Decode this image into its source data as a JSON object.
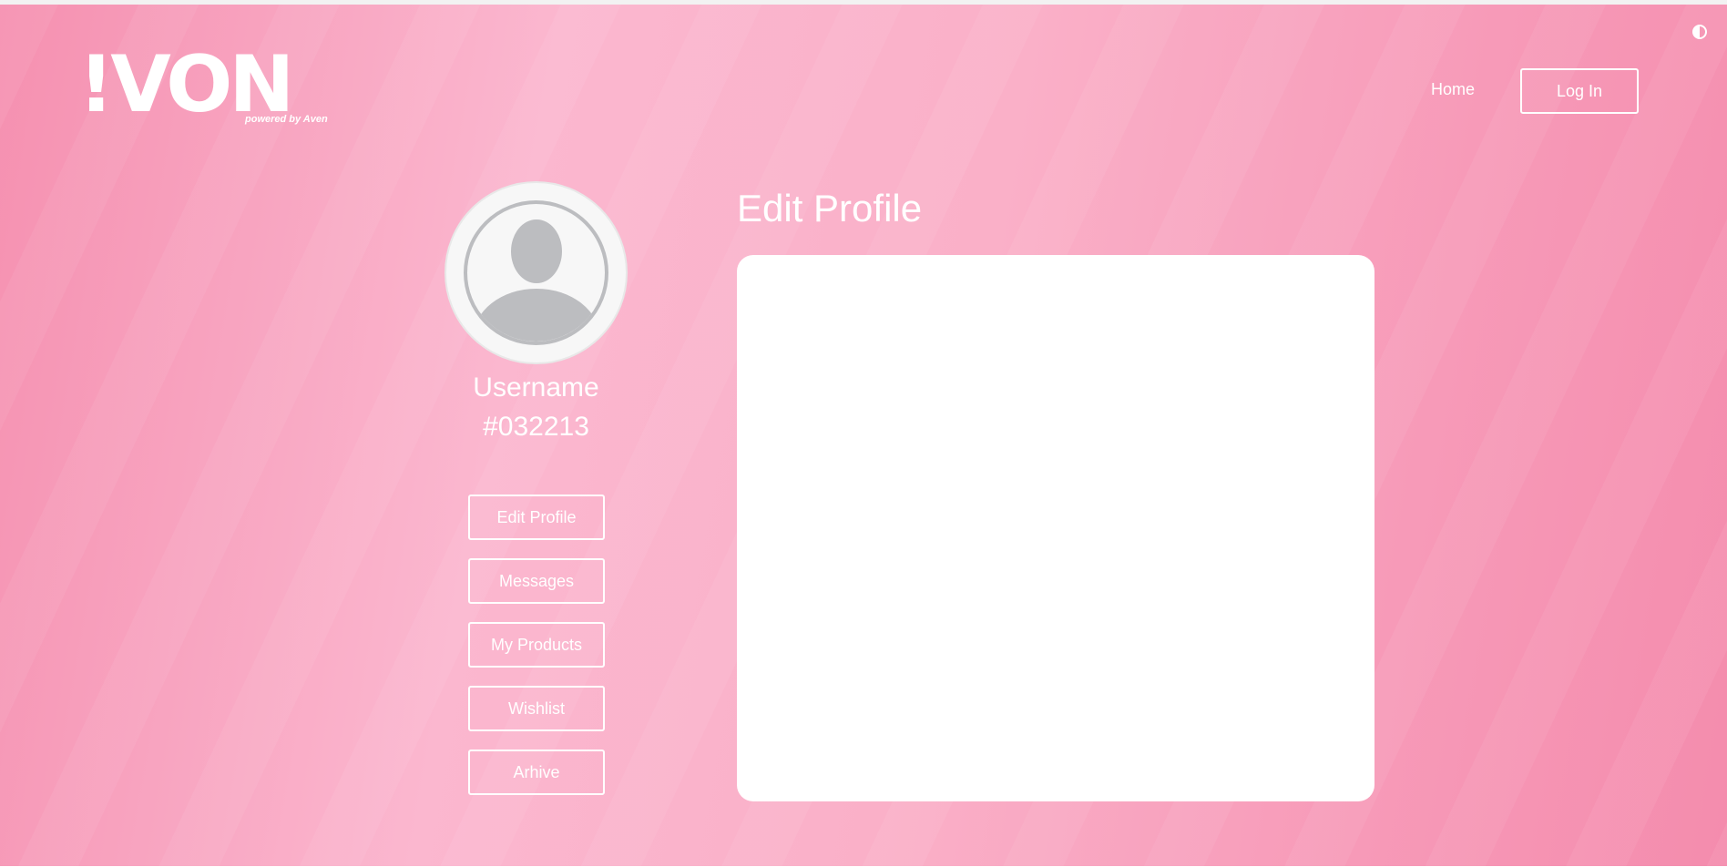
{
  "header": {
    "logo_text": "!VON",
    "logo_tagline": "powered by Aven",
    "theme_icon": "half-circle-contrast-icon",
    "nav": {
      "home_label": "Home",
      "login_label": "Log In"
    }
  },
  "profile": {
    "avatar_icon": "default-user-avatar-icon",
    "username": "Username",
    "user_id": "#032213"
  },
  "sidebar": {
    "items": [
      {
        "label": "Edit Profile"
      },
      {
        "label": "Messages"
      },
      {
        "label": "My Products"
      },
      {
        "label": "Wishlist"
      },
      {
        "label": "Arhive"
      }
    ]
  },
  "main": {
    "title": "Edit Profile"
  },
  "colors": {
    "background_pink": "#f8a3c0",
    "text_white": "#ffffff",
    "avatar_gray": "#bcbdc0"
  }
}
